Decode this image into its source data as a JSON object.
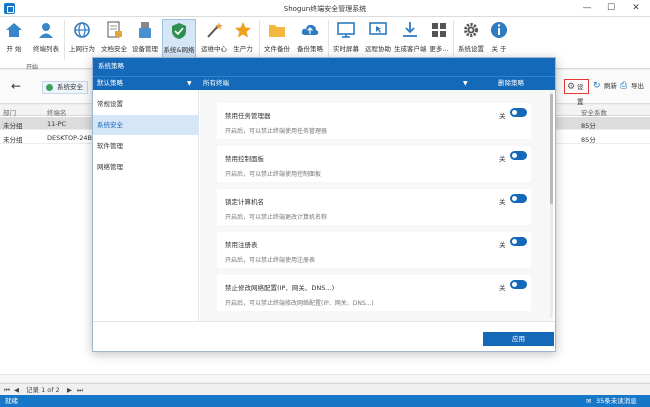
{
  "window": {
    "title": "Shogun终端安全管理系统",
    "minimize": "—",
    "maximize": "☐",
    "close": "✕"
  },
  "ribbon": {
    "group_label": "开始",
    "buttons": [
      {
        "label": "开 始"
      },
      {
        "label": "终端列表"
      },
      {
        "label": "上网行为"
      },
      {
        "label": "文档安全"
      },
      {
        "label": "设备管理"
      },
      {
        "label": "系统&网络"
      },
      {
        "label": "运维中心"
      },
      {
        "label": "生产力"
      },
      {
        "label": "文件备份"
      },
      {
        "label": "备份策略"
      },
      {
        "label": "实时屏幕"
      },
      {
        "label": "远程协助"
      },
      {
        "label": "生成客户端"
      },
      {
        "label": "更多..."
      },
      {
        "label": "系统设置"
      },
      {
        "label": "关 于"
      }
    ]
  },
  "toolbar": {
    "back": "←",
    "chip": "系统安全",
    "settings": "设置",
    "refresh": "刷新",
    "export": "导出"
  },
  "table": {
    "columns": [
      "部门",
      "终端名",
      "安全系数"
    ],
    "rows": [
      {
        "dept": "未分组",
        "name": "11-PC",
        "score": "85分"
      },
      {
        "dept": "未分组",
        "name": "DESKTOP-24B",
        "score": "85分"
      }
    ]
  },
  "pager": {
    "record": "记录 1 of 2"
  },
  "status": {
    "left": "就绪",
    "right": "35条未读消息"
  },
  "modal": {
    "title": "系统策略",
    "policy_select": "默认策略",
    "terminal_select": "所有终端",
    "delete_policy": "删除策略",
    "side_items": [
      "常规设置",
      "系统安全",
      "软件管理",
      "网络管理"
    ],
    "cards": [
      {
        "title": "禁用任务管理器",
        "desc": "开启后，可以禁止终端使用任务管理器",
        "state": "关"
      },
      {
        "title": "禁用控制面板",
        "desc": "开启后，可以禁止终端使用控制面板",
        "state": "关"
      },
      {
        "title": "锁定计算机名",
        "desc": "开启后，可以禁止终端更改计算机名称",
        "state": "关"
      },
      {
        "title": "禁用注册表",
        "desc": "开启后，可以禁止终端使用注册表",
        "state": "关"
      },
      {
        "title": "禁止修改网络配置(IP、网关、DNS...)",
        "desc": "开启后，可以禁止终端修改网络配置(IP、网关、DNS...)",
        "state": "关"
      }
    ],
    "apply": "应用"
  },
  "colors": {
    "accent": "#1569b9",
    "highlight": "#e53935"
  }
}
